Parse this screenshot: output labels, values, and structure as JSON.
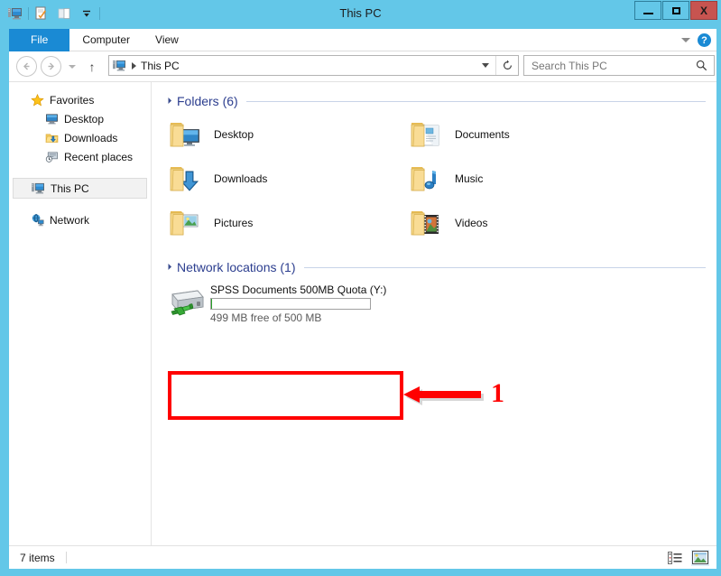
{
  "window": {
    "title": "This PC",
    "quick_access": [
      {
        "name": "this-pc-icon",
        "label": "This PC"
      },
      {
        "name": "properties-icon",
        "label": "Properties"
      },
      {
        "name": "new-folder-icon",
        "label": "New folder"
      },
      {
        "name": "customize-chevron-icon",
        "label": "Customize Quick Access Toolbar"
      }
    ],
    "controls": {
      "minimize": "Minimize",
      "maximize": "Maximize",
      "close": "X",
      "close_color": "#c75450"
    },
    "titlebar_color": "#63c7e8"
  },
  "ribbon": {
    "tabs": [
      {
        "label": "File",
        "active": true
      },
      {
        "label": "Computer",
        "active": false
      },
      {
        "label": "View",
        "active": false
      }
    ],
    "file_tab_color": "#1a8ad4",
    "expand_icon": "chevron-down-icon",
    "help_label": "?"
  },
  "navigation": {
    "back_glyph": "←",
    "forward_glyph": "→",
    "recent_glyph": "dropdown-icon",
    "up_glyph": "↑",
    "address": {
      "icon": "this-pc-icon",
      "path": "This PC",
      "chevron": "chevron-down-icon",
      "refresh_glyph": "↻"
    },
    "search": {
      "placeholder": "Search This PC",
      "value": "",
      "icon": "search-icon"
    }
  },
  "sidebar": {
    "items": [
      {
        "label": "Favorites",
        "icon": "star-icon",
        "level": "root",
        "selected": false
      },
      {
        "label": "Desktop",
        "icon": "desktop-icon",
        "level": "child",
        "selected": false
      },
      {
        "label": "Downloads",
        "icon": "downloads-folder-icon",
        "level": "child",
        "selected": false
      },
      {
        "label": "Recent places",
        "icon": "recent-places-icon",
        "level": "child",
        "selected": false
      },
      {
        "label": "This PC",
        "icon": "this-pc-icon",
        "level": "root",
        "selected": true
      },
      {
        "label": "Network",
        "icon": "network-icon",
        "level": "root",
        "selected": false
      }
    ]
  },
  "content": {
    "groups": [
      {
        "title": "Folders (6)",
        "name": "folders-group",
        "items": [
          {
            "label": "Desktop",
            "icon": "desktop-folder-icon"
          },
          {
            "label": "Documents",
            "icon": "documents-folder-icon"
          },
          {
            "label": "Downloads",
            "icon": "downloads-folder-icon"
          },
          {
            "label": "Music",
            "icon": "music-folder-icon"
          },
          {
            "label": "Pictures",
            "icon": "pictures-folder-icon"
          },
          {
            "label": "Videos",
            "icon": "videos-folder-icon"
          }
        ]
      }
    ],
    "network_group": {
      "title": "Network locations (1)",
      "name": "network-locations-group",
      "drive": {
        "name": "SPSS Documents 500MB Quota (Y:)",
        "icon": "network-drive-icon",
        "free_text": "499 MB free of 500 MB",
        "used_percent": 0.2,
        "bar_color": "#29a329"
      }
    }
  },
  "annotation": {
    "number": "1",
    "color": "#ff0000",
    "arrow": "left-arrow-icon",
    "target": "network-drive-tile"
  },
  "statusbar": {
    "item_count": "7 items",
    "views": [
      {
        "name": "details-view-button",
        "label": "Details view",
        "active": false
      },
      {
        "name": "large-icons-view-button",
        "label": "Large icons view",
        "active": true
      }
    ]
  }
}
